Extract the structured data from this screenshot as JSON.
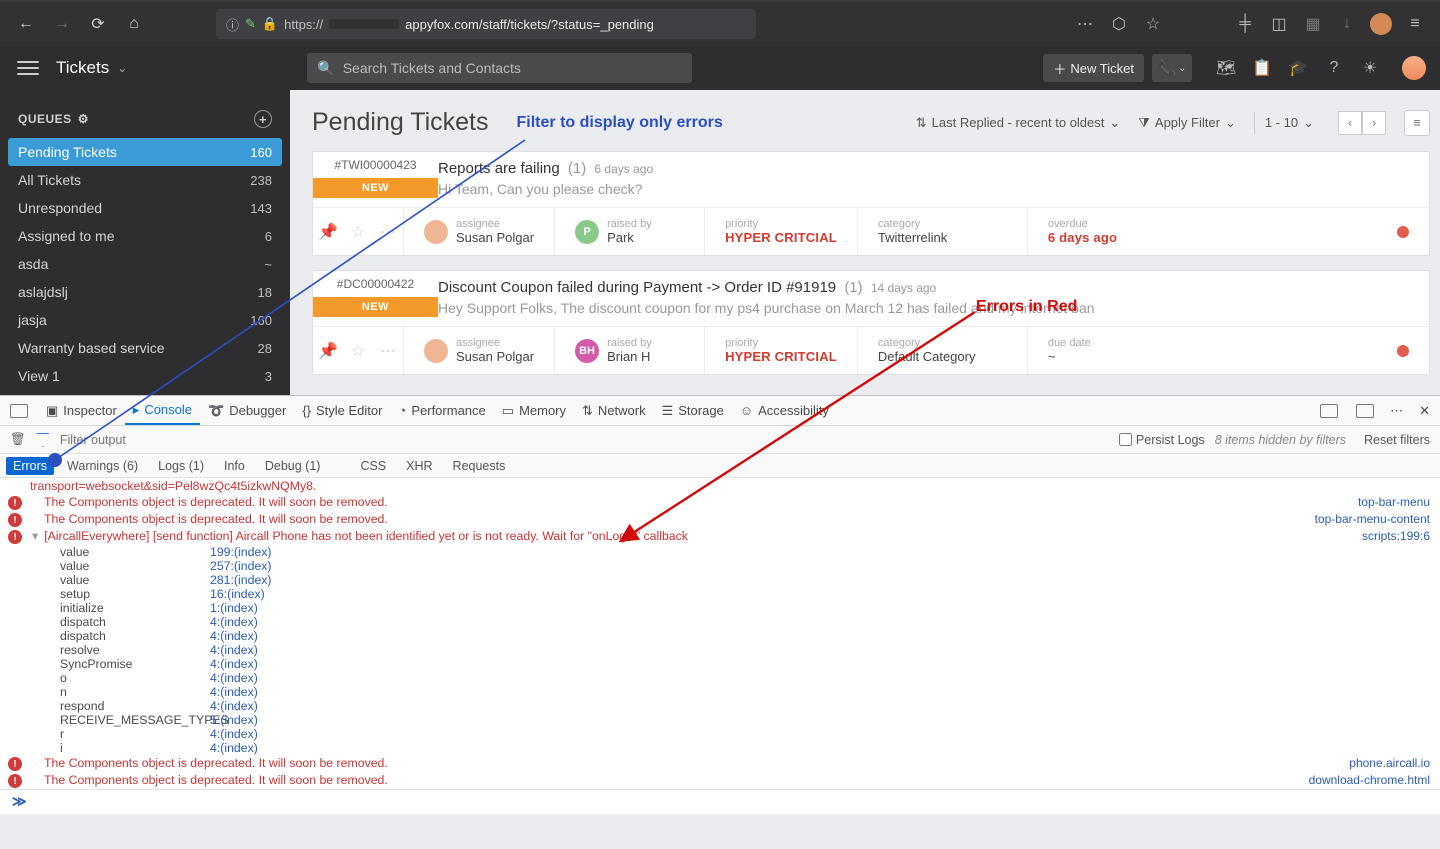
{
  "browser": {
    "url_prefix": "https://",
    "url_domain_suffix": "appyfox.com",
    "url_path": "/staff/tickets/?status=_pending"
  },
  "hf_top": {
    "title": "Tickets",
    "search_placeholder": "Search Tickets and Contacts",
    "new_ticket": "New Ticket"
  },
  "sidebar": {
    "header": "QUEUES",
    "items": [
      {
        "label": "Pending Tickets",
        "count": "160",
        "selected": true
      },
      {
        "label": "All Tickets",
        "count": "238"
      },
      {
        "label": "Unresponded",
        "count": "143"
      },
      {
        "label": "Assigned to me",
        "count": "6"
      },
      {
        "label": "asda",
        "count": "~"
      },
      {
        "label": "aslajdslj",
        "count": "18"
      },
      {
        "label": "jasja",
        "count": "160"
      },
      {
        "label": "Warranty based service",
        "count": "28"
      },
      {
        "label": "View 1",
        "count": "3"
      }
    ]
  },
  "main_head": {
    "title": "Pending Tickets",
    "annot_filter": "Filter to display only errors",
    "sort": "Last Replied - recent to oldest",
    "apply_filter": "Apply Filter",
    "range": "1 - 10",
    "annot_red": "Errors in Red"
  },
  "tickets": [
    {
      "id": "#TWI00000423",
      "badge": "NEW",
      "title": "Reports are failing",
      "count": "(1)",
      "ago": "6 days ago",
      "snippet": "Hi Team, Can you please check?",
      "assignee_label": "assignee",
      "assignee": "Susan Polgar",
      "raised_label": "raised by",
      "raised": "Park",
      "av_letter": "P",
      "av_class": "g",
      "prio_label": "priority",
      "prio": "HYPER CRITCIAL",
      "cat_label": "category",
      "cat": "Twitterrelink",
      "due_label": "overdue",
      "due": "6 days ago",
      "due_red": true
    },
    {
      "id": "#DC00000422",
      "badge": "NEW",
      "title": "Discount Coupon failed during Payment -> Order ID #91919",
      "count": "(1)",
      "ago": "14 days ago",
      "snippet": "Hey Support Folks, The discount coupon for my ps4 purchase on March 12 has failed and my internet ban",
      "assignee_label": "assignee",
      "assignee": "Susan Polgar",
      "raised_label": "raised by",
      "raised": "Brian H",
      "av_letter": "BH",
      "av_class": "p",
      "prio_label": "priority",
      "prio": "HYPER CRITCIAL",
      "cat_label": "category",
      "cat": "Default Category",
      "due_label": "due date",
      "due": "~",
      "due_red": false
    }
  ],
  "devtools": {
    "tabs": [
      "Inspector",
      "Console",
      "Debugger",
      "Style Editor",
      "Performance",
      "Memory",
      "Network",
      "Storage",
      "Accessibility"
    ],
    "active_tab": "Console",
    "filter_placeholder": "Filter output",
    "persist": "Persist Logs",
    "hidden": "8 items hidden by filters",
    "reset": "Reset filters",
    "cats": [
      {
        "label": "Errors",
        "active": true
      },
      {
        "label": "Warnings (6)"
      },
      {
        "label": "Logs (1)"
      },
      {
        "label": "Info"
      },
      {
        "label": "Debug (1)"
      },
      {
        "label": "CSS"
      },
      {
        "label": "XHR"
      },
      {
        "label": "Requests"
      }
    ],
    "lines": [
      {
        "kind": "err-cont",
        "text": "transport=websocket&sid=Pel8wzQc4t5izkwNQMy8.",
        "src": ""
      },
      {
        "kind": "err",
        "text": "The Components object is deprecated. It will soon be removed.",
        "src": "top-bar-menu"
      },
      {
        "kind": "err",
        "text": "The Components object is deprecated. It will soon be removed.",
        "src": "top-bar-menu-content"
      },
      {
        "kind": "err-exp",
        "text": "[AircallEverywhere] [send function] Aircall Phone has not been identified yet or is not ready. Wait for \"onLogin\" callback",
        "src": "scripts:199:6"
      },
      {
        "kind": "err",
        "text": "The Components object is deprecated. It will soon be removed.",
        "src": "phone.aircall.io"
      },
      {
        "kind": "err",
        "text": "The Components object is deprecated. It will soon be removed.",
        "src": "download-chrome.html"
      }
    ],
    "stack": [
      {
        "fn": "value",
        "loc": "199:(index)"
      },
      {
        "fn": "value",
        "loc": "257:(index)"
      },
      {
        "fn": "value",
        "loc": "281:(index)"
      },
      {
        "fn": "setup",
        "loc": "16:(index)"
      },
      {
        "fn": "initialize",
        "loc": "1:(index)"
      },
      {
        "fn": "dispatch",
        "loc": "4:(index)"
      },
      {
        "fn": "dispatch",
        "loc": "4:(index)"
      },
      {
        "fn": "resolve",
        "loc": "4:(index)"
      },
      {
        "fn": "SyncPromise",
        "loc": "4:(index)"
      },
      {
        "fn": "o",
        "loc": "4:(index)"
      },
      {
        "fn": "n",
        "loc": "4:(index)"
      },
      {
        "fn": "respond",
        "loc": "4:(index)"
      },
      {
        "fn": "RECEIVE_MESSAGE_TYPES",
        "loc": "5:(index)"
      },
      {
        "fn": "r",
        "loc": "4:(index)"
      },
      {
        "fn": "i",
        "loc": "4:(index)"
      }
    ],
    "prompt": "≫"
  }
}
